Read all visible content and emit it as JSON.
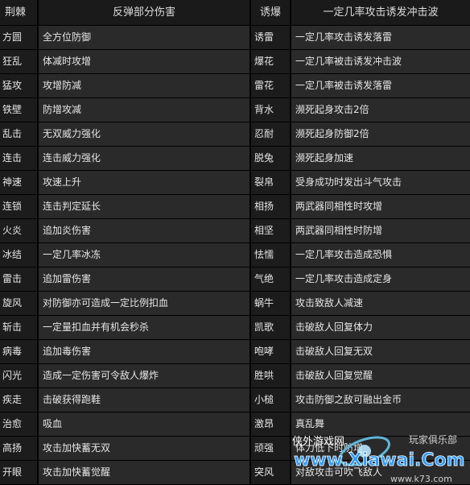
{
  "table": {
    "headers": [
      "荆棘",
      "反弹部分伤害",
      "诱爆",
      "一定几率攻击诱发冲击波"
    ],
    "rows": [
      [
        "方圆",
        "全方位防御",
        "诱雷",
        "一定几率攻击诱发落雷"
      ],
      [
        "狂乱",
        "体减时攻增",
        "爆花",
        "一定几率被击诱发冲击波"
      ],
      [
        "猛攻",
        "攻增防减",
        "雷花",
        "一定几率被击诱发落雷"
      ],
      [
        "铁壁",
        "防增攻减",
        "背水",
        "濒死起身攻击2倍"
      ],
      [
        "乱击",
        "无双威力强化",
        "忍耐",
        "濒死起身防御2倍"
      ],
      [
        "连击",
        "连击威力强化",
        "脱兔",
        "濒死起身加速"
      ],
      [
        "神速",
        "攻速上升",
        "裂帛",
        "受身成功时发出斗气攻击"
      ],
      [
        "连锁",
        "连击判定延长",
        "相扬",
        "两武器同相性时攻增"
      ],
      [
        "火炎",
        "追加炎伤害",
        "相坚",
        "两武器同相性时防增"
      ],
      [
        "冰结",
        "一定几率冰冻",
        "怯懦",
        "一定几率攻击造成恐惧"
      ],
      [
        "雷击",
        "追加雷伤害",
        "气绝",
        "一定几率攻击造成定身"
      ],
      [
        "旋风",
        "对防御亦可造成一定比例扣血",
        "蜗牛",
        "攻击致敌人减速"
      ],
      [
        "斩击",
        "一定量扣血并有机会秒杀",
        "凯歌",
        "击破敌人回复体力"
      ],
      [
        "病毒",
        "追加毒伤害",
        "咆哮",
        "击破敌人回复无双"
      ],
      [
        "闪光",
        "造成一定伤害可令敌人爆炸",
        "胜哄",
        "击破敌人回复觉醒"
      ],
      [
        "疾走",
        "击破获得跑鞋",
        "小槌",
        "攻击防御之敌可融出金币"
      ],
      [
        "治愈",
        "吸血",
        "激昂",
        "真乱舞"
      ],
      [
        "高扬",
        "攻击加快蓄无双",
        "顽强",
        "体力低下时防增"
      ],
      [
        "开眼",
        "攻击加快蓄觉醒",
        "突风",
        "对敌攻击可吹飞敌人"
      ]
    ]
  },
  "watermark": {
    "site_cn": "侠外游戏网",
    "site_right": "玩家俱乐部",
    "logo": "www.Xiawai.Com",
    "url": "www.k73.com"
  }
}
